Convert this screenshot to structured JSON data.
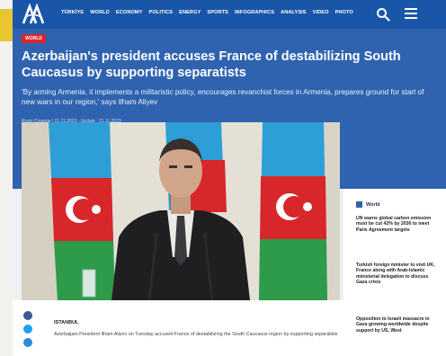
{
  "header": {
    "brand_color": "#1a56a8",
    "nav": [
      "TÜRKİYE",
      "WORLD",
      "ECONOMY",
      "POLITICS",
      "ENERGY",
      "SPORTS",
      "INFOGRAPHICS",
      "ANALYSIS",
      "VIDEO",
      "PHOTO"
    ]
  },
  "article": {
    "category": "WORLD",
    "headline": "Azerbaijan's president accuses France of destabilizing South Caucasus by supporting separatists",
    "subhead": "'By arming Armenia, it implements a militaristic policy, encourages revanchist forces in Armenia, prepares ground for start of new wars in our region,' says Ilham Aliyev",
    "byline": "Rusiy Cinagge  |  21.11.2023 - Update : 21.11.2023",
    "dateline": "ISTANBUL",
    "lead": "Azerbaijani President Ilham Aliyev on Tuesday accused France of destabilizing the South Caucasus region by supporting separatists"
  },
  "sidebar": {
    "section": "World",
    "items": [
      "UN warns global carbon emission must be cut 42% by 2030 to meet Paris Agreement targets",
      "Turkish foreign minister to visit UK, France along with Arab-Islamic ministerial delegation to discuss Gaza crisis",
      "Opposition to Israeli massacre in Gaza growing worldwide despite support by US, West"
    ]
  },
  "icons": {
    "logo": "aa-logo-icon",
    "search": "search-icon",
    "menu": "hamburger-menu-icon",
    "share": [
      "facebook-icon",
      "twitter-icon",
      "telegram-icon"
    ]
  }
}
